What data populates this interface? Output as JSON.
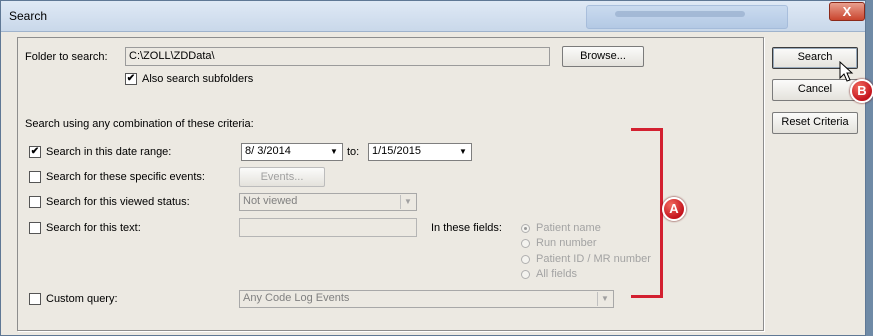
{
  "window": {
    "title": "Search",
    "close_glyph": "X"
  },
  "folder": {
    "label": "Folder to search:",
    "value": "C:\\ZOLL\\ZDData\\",
    "browse_label": "Browse...",
    "subfolders_label": "Also search subfolders",
    "subfolders_checked": true
  },
  "buttons": {
    "search": "Search",
    "cancel": "Cancel",
    "reset": "Reset Criteria"
  },
  "criteria": {
    "heading": "Search using any combination of these criteria:",
    "date_range": {
      "label": "Search in this date range:",
      "checked": true,
      "from": "8/  3/2014",
      "to_label": "to:",
      "to": "1/15/2015"
    },
    "events": {
      "label": "Search for these specific events:",
      "checked": false,
      "button": "Events..."
    },
    "viewed": {
      "label": "Search for this viewed status:",
      "checked": false,
      "value": "Not viewed"
    },
    "text": {
      "label": "Search for this text:",
      "checked": false,
      "value": "",
      "fields_label": "In these fields:",
      "fields": [
        "Patient name",
        "Run number",
        "Patient ID / MR number",
        "All fields"
      ],
      "selected_field": "Patient name"
    },
    "custom": {
      "label": "Custom query:",
      "checked": false,
      "value": "Any Code Log Events"
    }
  },
  "annotations": {
    "a": "A",
    "b": "B"
  },
  "icons": {
    "dropdown": "▼",
    "check": "✔"
  },
  "colors": {
    "annotation_red": "#d32030",
    "titlebar": "#c9d8ea",
    "dialog_bg": "#ece9e2"
  }
}
